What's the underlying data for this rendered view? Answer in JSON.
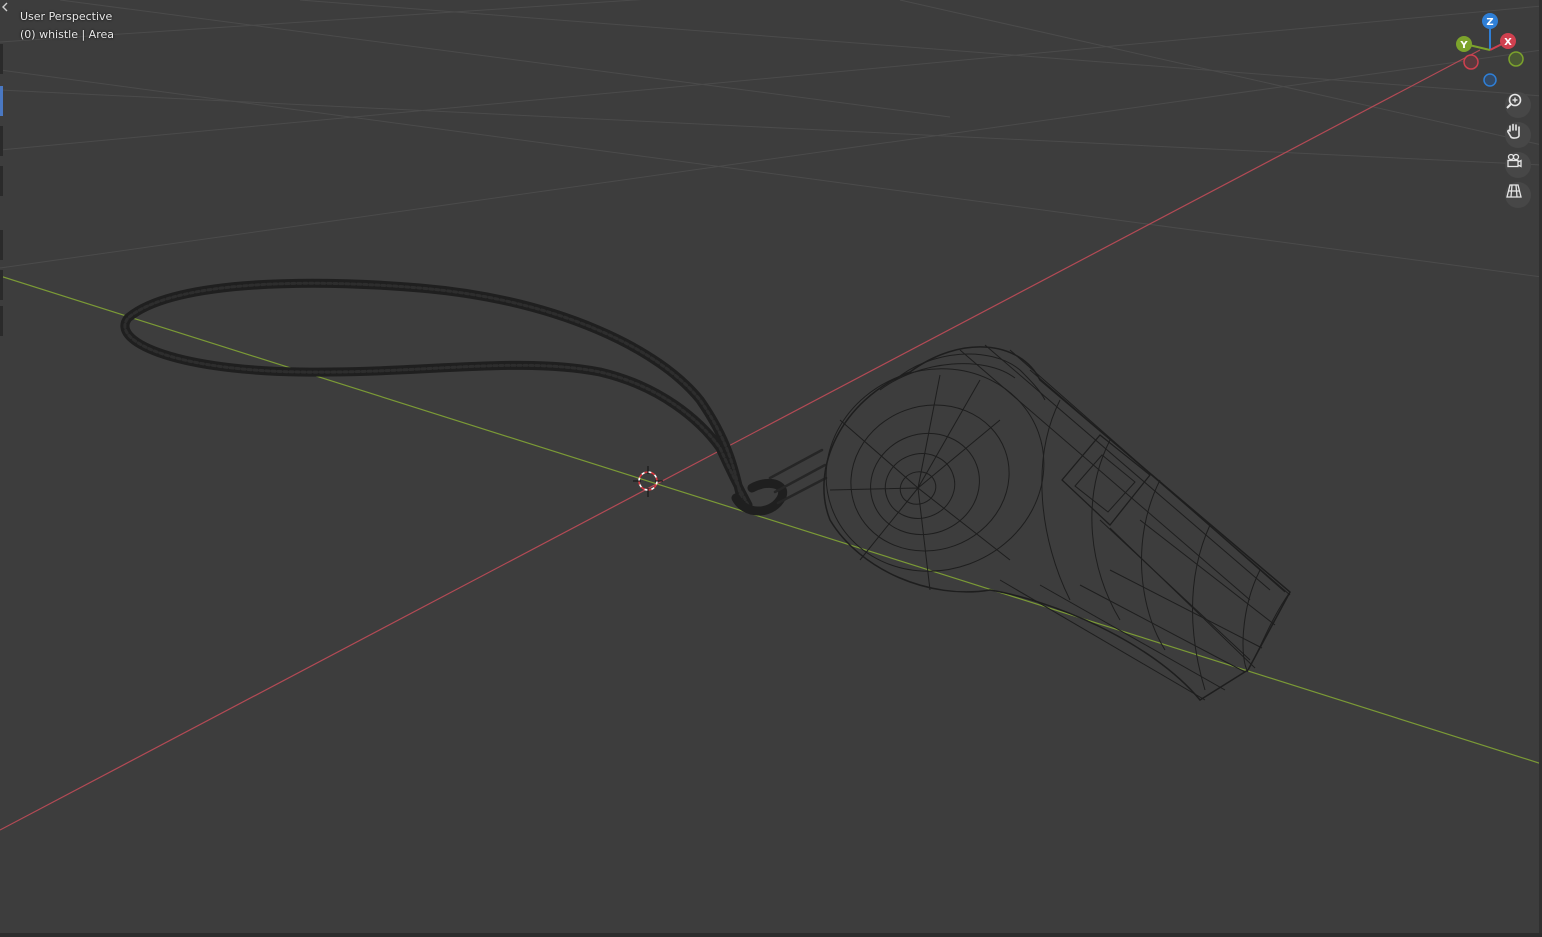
{
  "viewport": {
    "view_name": "User Perspective",
    "object_info": "(0) whistle | Area"
  },
  "gizmo": {
    "axis_z": "Z",
    "axis_x": "X",
    "axis_y": "Y",
    "color_x": "#d0404f",
    "color_y": "#7ca32c",
    "color_z": "#2f7fd6"
  },
  "nav_buttons": [
    {
      "icon": "zoom-icon"
    },
    {
      "icon": "hand-pan-icon"
    },
    {
      "icon": "camera-view-icon"
    },
    {
      "icon": "grid-ortho-icon"
    }
  ],
  "colors": {
    "background": "#3d3d3d",
    "grid": "#4a4a4a",
    "axis_x_line": "#b34a55",
    "axis_y_line": "#7b9a36",
    "wire": "#1e1e1e"
  }
}
